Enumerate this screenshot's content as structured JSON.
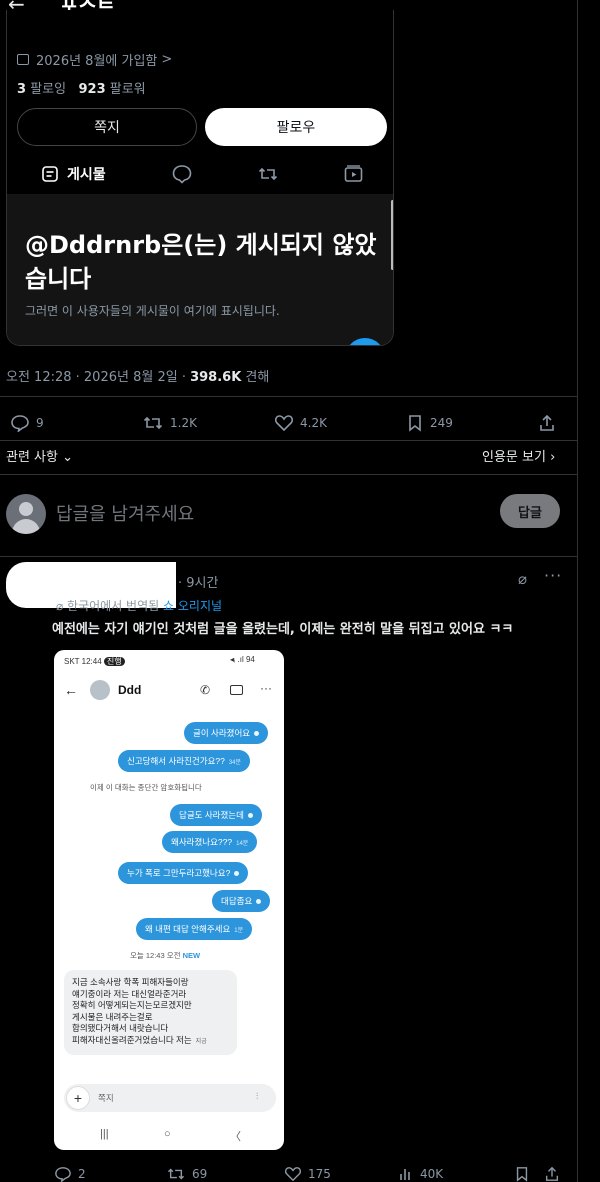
{
  "header": {
    "back_icon": "←",
    "title": "포스트"
  },
  "profile": {
    "joined": "2026년 8월에 가입함",
    "following_count": "3",
    "following_label": "팔로잉",
    "followers_count": "923",
    "followers_label": "팔로워",
    "dm_label": "쪽지",
    "follow_label": "팔로우",
    "tabs": {
      "posts_label": "게시물"
    },
    "empty_title": "@Dddrnrb은(는) 게시되지 않았습니다",
    "empty_sub": "그러면 이 사용자들의 게시물이 여기에 표시됩니다."
  },
  "post": {
    "time": "오전 12:28 · 2026년 8월 2일 · ",
    "views_count": "398.6K",
    "views_label": " 견해",
    "replies": "9",
    "reposts": "1.2K",
    "likes": "4.2K",
    "bookmarks": "249",
    "related_label": "관련 사항",
    "quotes_label": "인용문 보기"
  },
  "reply_box": {
    "placeholder": "답글을 남겨주세요",
    "button": "답글"
  },
  "reply_tweet": {
    "time": "· 9시간",
    "translated_label": "한국어에서 번역됨",
    "original_link": "쇼 오리지널",
    "text": "예전에는 자기 얘기인 것처럼 글을 올렸는데, 이제는 완전히 말을 뒤집고 있어요 ㅋㅋ",
    "replies": "2",
    "reposts": "69",
    "likes": "175",
    "views": "40K"
  },
  "phone": {
    "status_left": "SKT 12:44",
    "status_badge": "진행",
    "status_right": "◂ᵢ .ıl 94",
    "contact": "Ddd",
    "messages": [
      {
        "text": "글이 사라졌어요",
        "time": ""
      },
      {
        "text": "신고당해서 사라진건가요??",
        "time": "34분"
      },
      {
        "text": "답글도 사라졌는데",
        "time": ""
      },
      {
        "text": "왜사라졌나요???",
        "time": "14분"
      },
      {
        "text": "누가 폭로 그만두라고했나요?",
        "time": ""
      },
      {
        "text": "대답좀요",
        "time": ""
      },
      {
        "text": "왜 내편 대답 안해주세요",
        "time": "1분"
      }
    ],
    "system_notice": "이제 이 대화는 종단간 암호화됩니다",
    "date_separator": "오늘 12:43 오전",
    "new_badge": "NEW",
    "received_lines": [
      "지금 소속사랑 학폭 피해자들이랑",
      "얘기중이라 저는 대신얼라준거라",
      "정확히 어떻게되는지는모르겠지만",
      "게시물은 내려주는걸로",
      "합의됐다거해서 내랏습니다",
      "피해자대신올려준거었습니다 저는"
    ],
    "received_time": "지금",
    "input_placeholder": "쪽지"
  },
  "colors": {
    "accent": "#1d9bf0",
    "bubble": "#2d95dc",
    "background": "#000000"
  }
}
